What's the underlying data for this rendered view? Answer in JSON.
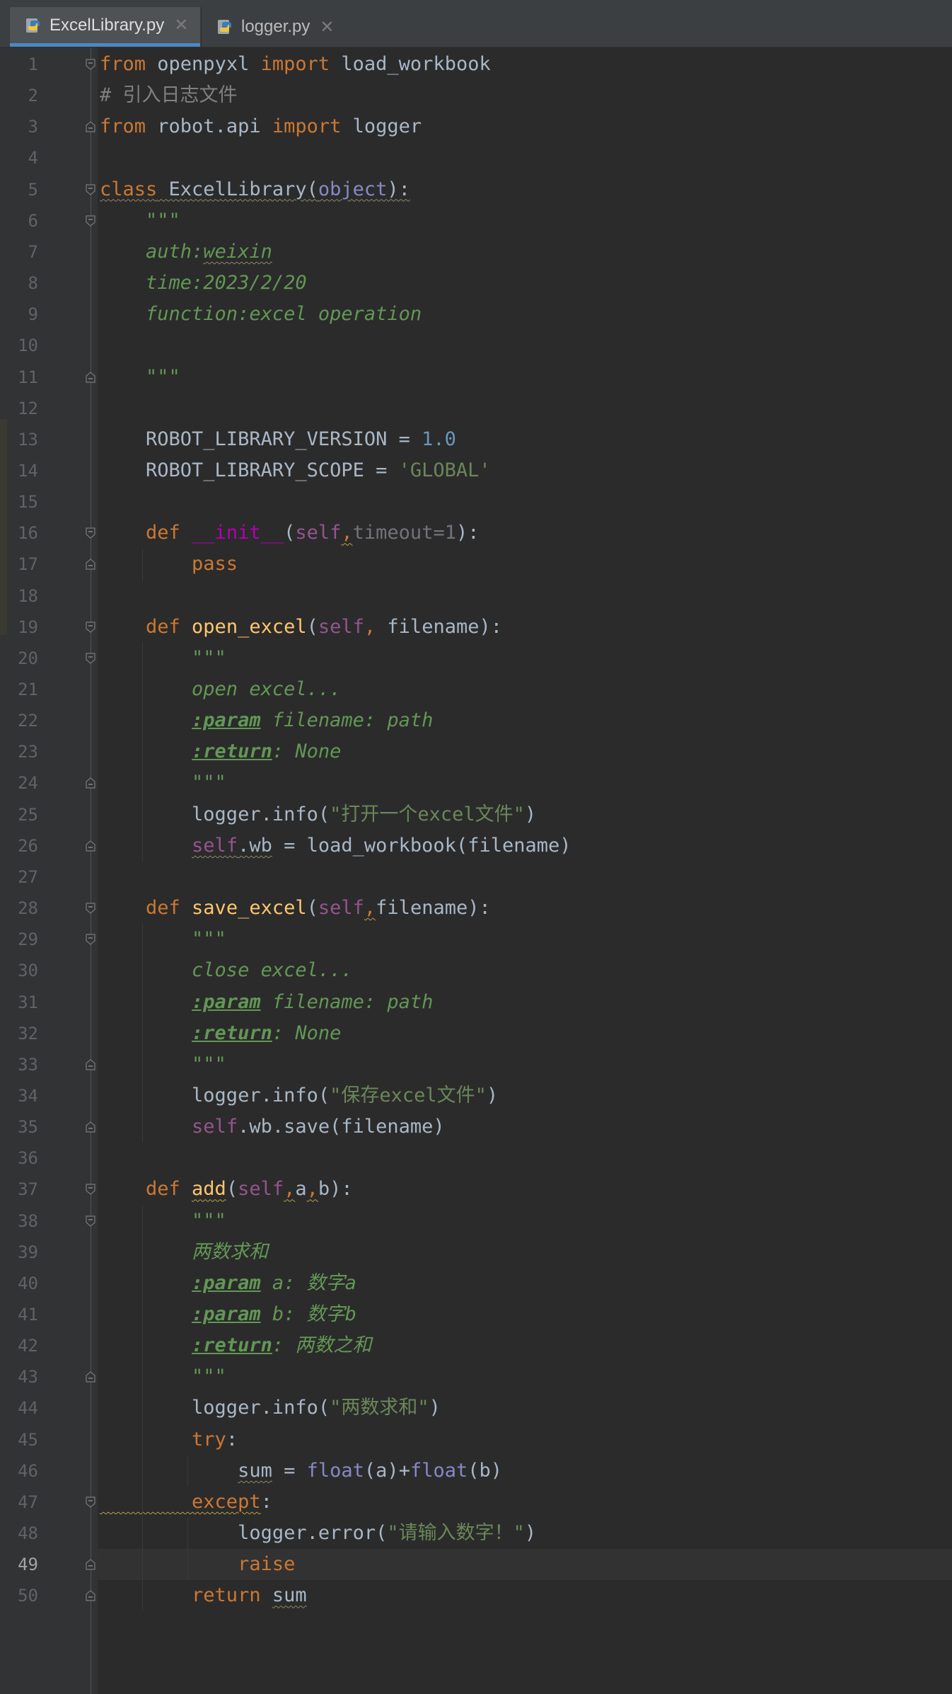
{
  "tabs": [
    {
      "label": "ExcelLibrary.py",
      "active": true,
      "icon": "python-file-icon"
    },
    {
      "label": "logger.py",
      "active": false,
      "icon": "python-file-icon"
    }
  ],
  "current_line": 49,
  "lines": [
    {
      "n": "1",
      "t": [
        [
          "kw",
          "from"
        ],
        [
          "p",
          " openpyxl "
        ],
        [
          "kw",
          "import"
        ],
        [
          "p",
          " load_workbook"
        ]
      ]
    },
    {
      "n": "2",
      "t": [
        [
          "cmt",
          "# 引入日志文件"
        ]
      ]
    },
    {
      "n": "3",
      "t": [
        [
          "kw",
          "from"
        ],
        [
          "p",
          " robot.api "
        ],
        [
          "kw",
          "import"
        ],
        [
          "p",
          " logger"
        ]
      ]
    },
    {
      "n": "4",
      "t": []
    },
    {
      "n": "5",
      "t": [
        [
          "kw wavyg",
          "class"
        ],
        [
          "p wavyg",
          " ExcelLibrary("
        ],
        [
          "builtin wavyg",
          "object"
        ],
        [
          "p wavyg",
          "):"
        ]
      ]
    },
    {
      "n": "6",
      "t": [
        [
          "doc",
          "    \"\"\""
        ]
      ]
    },
    {
      "n": "7",
      "t": [
        [
          "doc",
          "    auth:"
        ],
        [
          "doc wavyg",
          "weixin"
        ]
      ]
    },
    {
      "n": "8",
      "t": [
        [
          "doc",
          "    time:2023/2/20"
        ]
      ]
    },
    {
      "n": "9",
      "t": [
        [
          "doc",
          "    function:excel operation"
        ]
      ]
    },
    {
      "n": "10",
      "t": []
    },
    {
      "n": "11",
      "t": [
        [
          "doc",
          "    \"\"\""
        ]
      ]
    },
    {
      "n": "12",
      "t": []
    },
    {
      "n": "13",
      "t": [
        [
          "p",
          "    ROBOT_LIBRARY_VERSION = "
        ],
        [
          "num",
          "1.0"
        ]
      ]
    },
    {
      "n": "14",
      "t": [
        [
          "p",
          "    ROBOT_LIBRARY_SCOPE = "
        ],
        [
          "str",
          "'GLOBAL'"
        ]
      ]
    },
    {
      "n": "15",
      "t": []
    },
    {
      "n": "16",
      "t": [
        [
          "kw",
          "    def "
        ],
        [
          "dunder",
          "__init__"
        ],
        [
          "p",
          "("
        ],
        [
          "self",
          "self"
        ],
        [
          "kw wavy",
          ","
        ],
        [
          "param",
          "timeout=1"
        ],
        [
          "p",
          "):"
        ]
      ]
    },
    {
      "n": "17",
      "t": [
        [
          "kw",
          "        pass"
        ]
      ]
    },
    {
      "n": "18",
      "t": []
    },
    {
      "n": "19",
      "t": [
        [
          "kw",
          "    def "
        ],
        [
          "fn",
          "open_excel"
        ],
        [
          "p",
          "("
        ],
        [
          "self",
          "self"
        ],
        [
          "kw",
          ", "
        ],
        [
          "p",
          "filename):"
        ]
      ]
    },
    {
      "n": "20",
      "t": [
        [
          "doc",
          "        \"\"\""
        ]
      ]
    },
    {
      "n": "21",
      "t": [
        [
          "doc",
          "        open excel..."
        ]
      ]
    },
    {
      "n": "22",
      "t": [
        [
          "doc",
          "        "
        ],
        [
          "doctag",
          ":param"
        ],
        [
          "doc",
          " filename: path"
        ]
      ]
    },
    {
      "n": "23",
      "t": [
        [
          "doc",
          "        "
        ],
        [
          "doctag",
          ":return"
        ],
        [
          "doc",
          ": None"
        ]
      ]
    },
    {
      "n": "24",
      "t": [
        [
          "doc",
          "        \"\"\""
        ]
      ]
    },
    {
      "n": "25",
      "t": [
        [
          "p",
          "        logger.info("
        ],
        [
          "str",
          "\"打开一个excel文件\""
        ],
        [
          "p",
          ")"
        ]
      ]
    },
    {
      "n": "26",
      "t": [
        [
          "p",
          "        "
        ],
        [
          "self wavyg",
          "self"
        ],
        [
          "p wavyg",
          ".wb"
        ],
        [
          "p",
          " = load_workbook(filename)"
        ]
      ]
    },
    {
      "n": "27",
      "t": []
    },
    {
      "n": "28",
      "t": [
        [
          "kw",
          "    def "
        ],
        [
          "fn",
          "save_excel"
        ],
        [
          "p",
          "("
        ],
        [
          "self",
          "self"
        ],
        [
          "kw wavy",
          ","
        ],
        [
          "p",
          "filename):"
        ]
      ]
    },
    {
      "n": "29",
      "t": [
        [
          "doc",
          "        \"\"\""
        ]
      ]
    },
    {
      "n": "30",
      "t": [
        [
          "doc",
          "        close excel..."
        ]
      ]
    },
    {
      "n": "31",
      "t": [
        [
          "doc",
          "        "
        ],
        [
          "doctag",
          ":param"
        ],
        [
          "doc",
          " filename: path"
        ]
      ]
    },
    {
      "n": "32",
      "t": [
        [
          "doc",
          "        "
        ],
        [
          "doctag",
          ":return"
        ],
        [
          "doc",
          ": None"
        ]
      ]
    },
    {
      "n": "33",
      "t": [
        [
          "doc",
          "        \"\"\""
        ]
      ]
    },
    {
      "n": "34",
      "t": [
        [
          "p",
          "        logger.info("
        ],
        [
          "str",
          "\"保存excel文件\""
        ],
        [
          "p",
          ")"
        ]
      ]
    },
    {
      "n": "35",
      "t": [
        [
          "p",
          "        "
        ],
        [
          "self",
          "self"
        ],
        [
          "p",
          ".wb.save(filename)"
        ]
      ]
    },
    {
      "n": "36",
      "t": []
    },
    {
      "n": "37",
      "t": [
        [
          "kw",
          "    def "
        ],
        [
          "fn wavy",
          "add"
        ],
        [
          "p",
          "("
        ],
        [
          "self",
          "self"
        ],
        [
          "kw wavy",
          ","
        ],
        [
          "p",
          "a"
        ],
        [
          "kw wavy",
          ","
        ],
        [
          "p",
          "b):"
        ]
      ]
    },
    {
      "n": "38",
      "t": [
        [
          "doc",
          "        \"\"\""
        ]
      ]
    },
    {
      "n": "39",
      "t": [
        [
          "doc",
          "        两数求和"
        ]
      ]
    },
    {
      "n": "40",
      "t": [
        [
          "doc",
          "        "
        ],
        [
          "doctag",
          ":param"
        ],
        [
          "doc",
          " a: 数字a"
        ]
      ]
    },
    {
      "n": "41",
      "t": [
        [
          "doc",
          "        "
        ],
        [
          "doctag",
          ":param"
        ],
        [
          "doc",
          " b: 数字b"
        ]
      ]
    },
    {
      "n": "42",
      "t": [
        [
          "doc",
          "        "
        ],
        [
          "doctag",
          ":return"
        ],
        [
          "doc",
          ": 两数之和"
        ]
      ]
    },
    {
      "n": "43",
      "t": [
        [
          "doc",
          "        \"\"\""
        ]
      ]
    },
    {
      "n": "44",
      "t": [
        [
          "p",
          "        logger.info("
        ],
        [
          "str",
          "\"两数求和\""
        ],
        [
          "p",
          ")"
        ]
      ]
    },
    {
      "n": "45",
      "t": [
        [
          "kw",
          "        try"
        ],
        [
          "p",
          ":"
        ]
      ]
    },
    {
      "n": "46",
      "t": [
        [
          "p",
          "            "
        ],
        [
          "p wavyg",
          "sum"
        ],
        [
          "p",
          " = "
        ],
        [
          "builtin",
          "float"
        ],
        [
          "p",
          "(a)+"
        ],
        [
          "builtin",
          "float"
        ],
        [
          "p",
          "(b)"
        ]
      ]
    },
    {
      "n": "47",
      "t": [
        [
          "kw wavy",
          "        except"
        ],
        [
          "p",
          ":"
        ]
      ]
    },
    {
      "n": "48",
      "t": [
        [
          "p",
          "            logger.error("
        ],
        [
          "str",
          "\"请输入数字！\""
        ],
        [
          "p",
          ")"
        ]
      ]
    },
    {
      "n": "49",
      "t": [
        [
          "kw",
          "            raise"
        ]
      ]
    },
    {
      "n": "50",
      "t": [
        [
          "kw",
          "        return "
        ],
        [
          "p wavyg",
          "sum"
        ]
      ]
    }
  ]
}
